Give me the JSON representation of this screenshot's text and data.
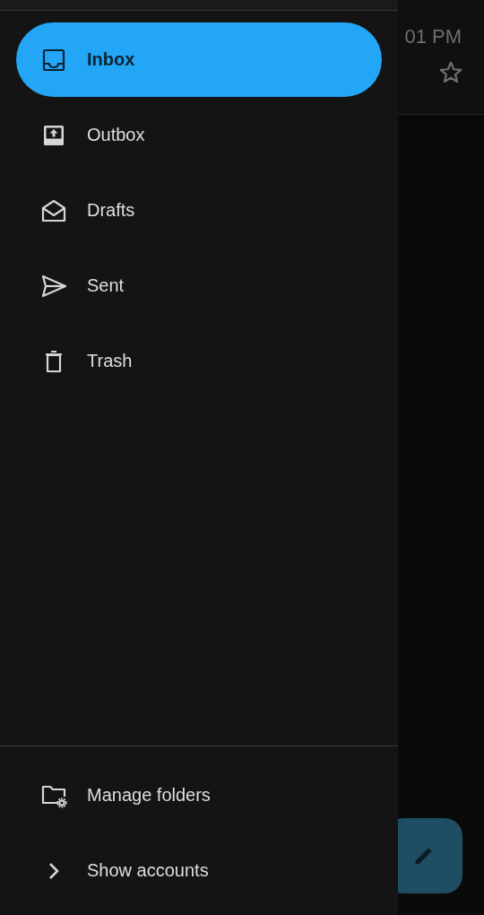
{
  "background_list": {
    "time": "01 PM",
    "starred": false
  },
  "drawer": {
    "folders": [
      {
        "label": "Inbox",
        "kind": "inbox",
        "selected": true
      },
      {
        "label": "Outbox",
        "kind": "outbox",
        "selected": false
      },
      {
        "label": "Drafts",
        "kind": "drafts",
        "selected": false
      },
      {
        "label": "Sent",
        "kind": "sent",
        "selected": false
      },
      {
        "label": "Trash",
        "kind": "trash",
        "selected": false
      }
    ],
    "footer": [
      {
        "label": "Manage folders",
        "kind": "manage"
      },
      {
        "label": "Show accounts",
        "kind": "expand"
      }
    ]
  }
}
